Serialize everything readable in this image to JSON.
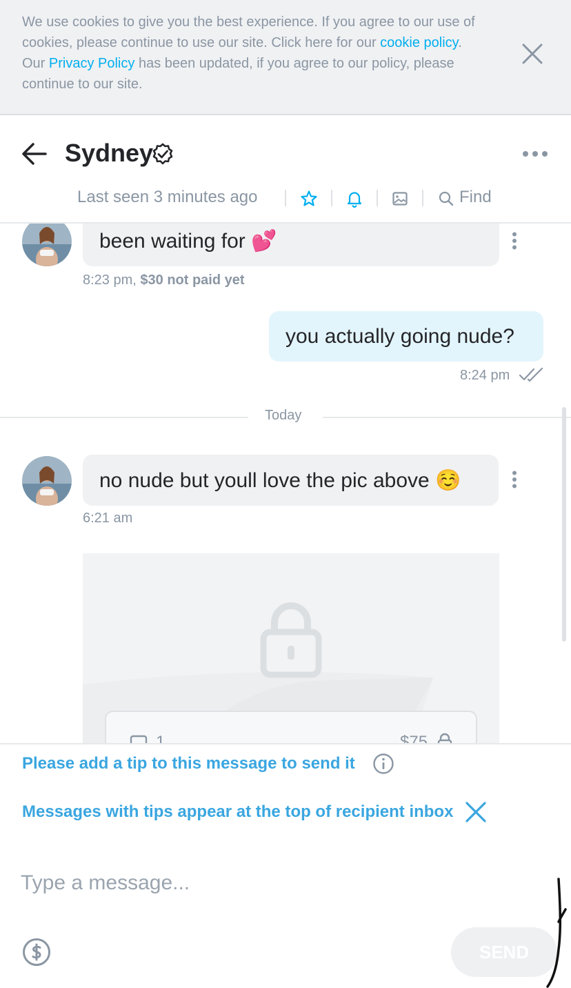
{
  "cookie_banner": {
    "text_1": "We use cookies to give you the best experience. If you agree to our use of cookies, please continue to use our site. Click here for our ",
    "cookie_policy_link": "cookie policy",
    "text_2": ". Our ",
    "privacy_policy_link": "Privacy Policy",
    "text_3": " has been updated, if you agree to our policy, please continue to our site.",
    "close_icon": "close-icon"
  },
  "header": {
    "title": "Sydney",
    "verified_icon": "verified-badge-icon",
    "last_seen": "Last seen 3 minutes ago",
    "find_label": "Find",
    "icons": [
      "star-icon",
      "bell-icon",
      "image-icon",
      "search-icon",
      "more-icon",
      "back-arrow-icon"
    ]
  },
  "messages": [
    {
      "direction": "incoming",
      "text": "been waiting for 💕",
      "time": "8:23 pm,",
      "price_status": "$30 not paid yet"
    },
    {
      "direction": "outgoing",
      "text": "you actually going nude?",
      "time": "8:24 pm"
    },
    {
      "direction": "incoming",
      "text": "no nude but youll love the pic above ☺️",
      "time": "6:21 am"
    }
  ],
  "divider": {
    "label": "Today"
  },
  "locked_media": {
    "count": "1",
    "price": "$75"
  },
  "composer": {
    "tip_notice": "Please add a tip to this message to send it",
    "tip_top_notice": "Messages with tips appear at the top of recipient inbox",
    "placeholder": "Type a message...",
    "send_label": "SEND"
  },
  "colors": {
    "accent": "#00aff0",
    "notice_blue": "#3aa6e0",
    "muted": "#8a96a3",
    "bubble_in": "#f0f1f3",
    "bubble_out": "#e3f5fc"
  }
}
